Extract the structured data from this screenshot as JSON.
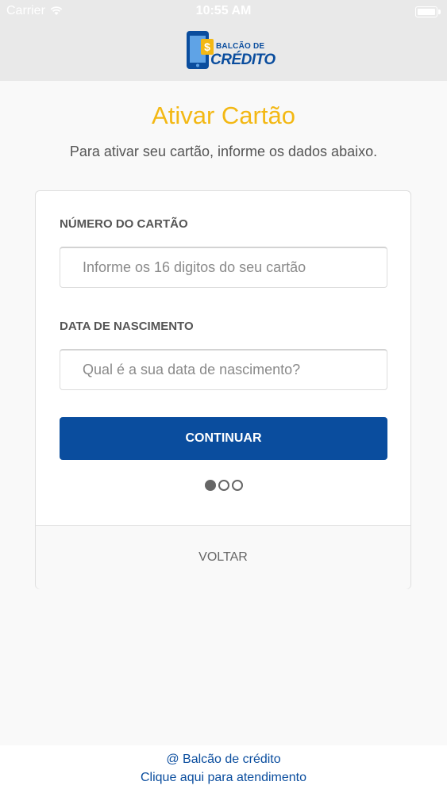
{
  "status_bar": {
    "carrier": "Carrier",
    "time": "10:55 AM"
  },
  "header": {
    "logo_line1": "BALCÃO DE",
    "logo_line2": "CRÉDITO"
  },
  "main": {
    "title": "Ativar Cartão",
    "subtitle": "Para ativar seu cartão, informe os dados abaixo."
  },
  "form": {
    "card_number_label": "NÚMERO DO CARTÃO",
    "card_number_placeholder": "Informe os 16 digitos do seu cartão",
    "birthdate_label": "DATA DE NASCIMENTO",
    "birthdate_placeholder": "Qual é a sua data de nascimento?",
    "continue_label": "CONTINUAR",
    "back_label": "VOLTAR",
    "step_current": 1,
    "step_total": 3
  },
  "footer": {
    "line1": "@ Balcão de crédito",
    "line2": "Clique aqui para atendimento"
  },
  "colors": {
    "accent_yellow": "#f3b814",
    "brand_blue": "#0a4d9e",
    "header_bg": "#e9e9e9"
  }
}
